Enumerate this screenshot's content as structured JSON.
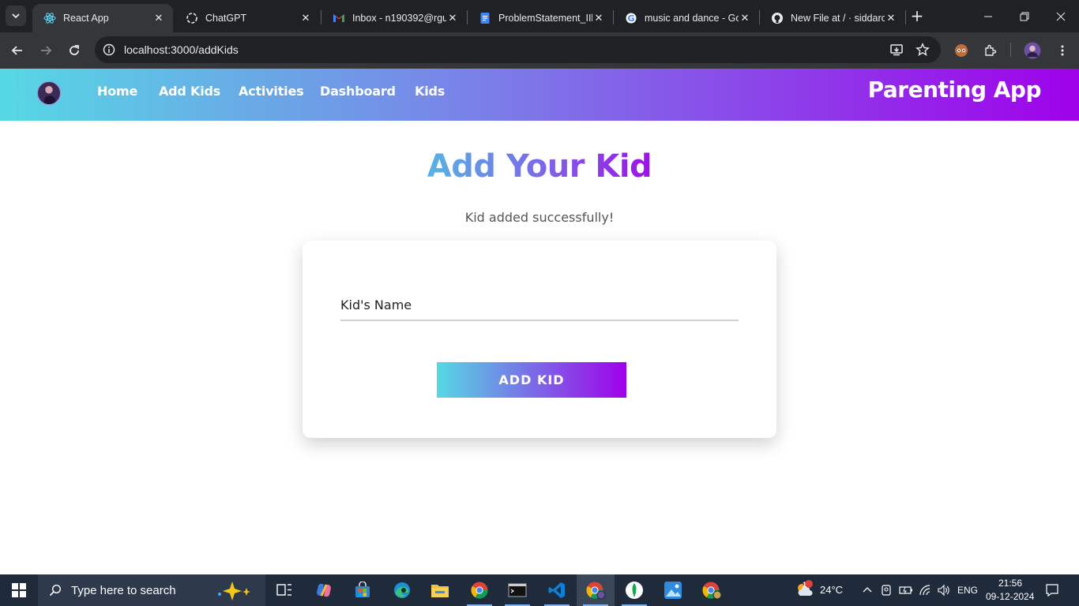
{
  "browser": {
    "tabs": [
      {
        "title": "React App",
        "favicon": "react-icon",
        "active": true
      },
      {
        "title": "ChatGPT",
        "favicon": "chatgpt-icon",
        "active": false
      },
      {
        "title": "Inbox - n190392@rgu",
        "favicon": "gmail-icon",
        "active": false
      },
      {
        "title": "ProblemStatement_IIl",
        "favicon": "docs-icon",
        "active": false
      },
      {
        "title": "music and dance - Go",
        "favicon": "google-icon",
        "active": false
      },
      {
        "title": "New File at / · siddarc",
        "favicon": "github-icon",
        "active": false
      }
    ],
    "url": "localhost:3000/addKids"
  },
  "app": {
    "nav": {
      "links": [
        "Home",
        "Add Kids",
        "Activities",
        "Dashboard",
        "Kids"
      ],
      "brand": "Parenting App"
    },
    "page_title": "Add Your Kid",
    "success_message": "Kid added successfully!",
    "form": {
      "name_placeholder": "Kid's Name",
      "name_value": "",
      "submit_label": "ADD KID"
    },
    "colors": {
      "gradient_start": "#56d8e4",
      "gradient_end": "#9f01ea"
    }
  },
  "taskbar": {
    "search_placeholder": "Type here to search",
    "weather_temp": "24°C",
    "weather_badge": "1",
    "language": "ENG",
    "time": "21:56",
    "date": "09-12-2024"
  }
}
